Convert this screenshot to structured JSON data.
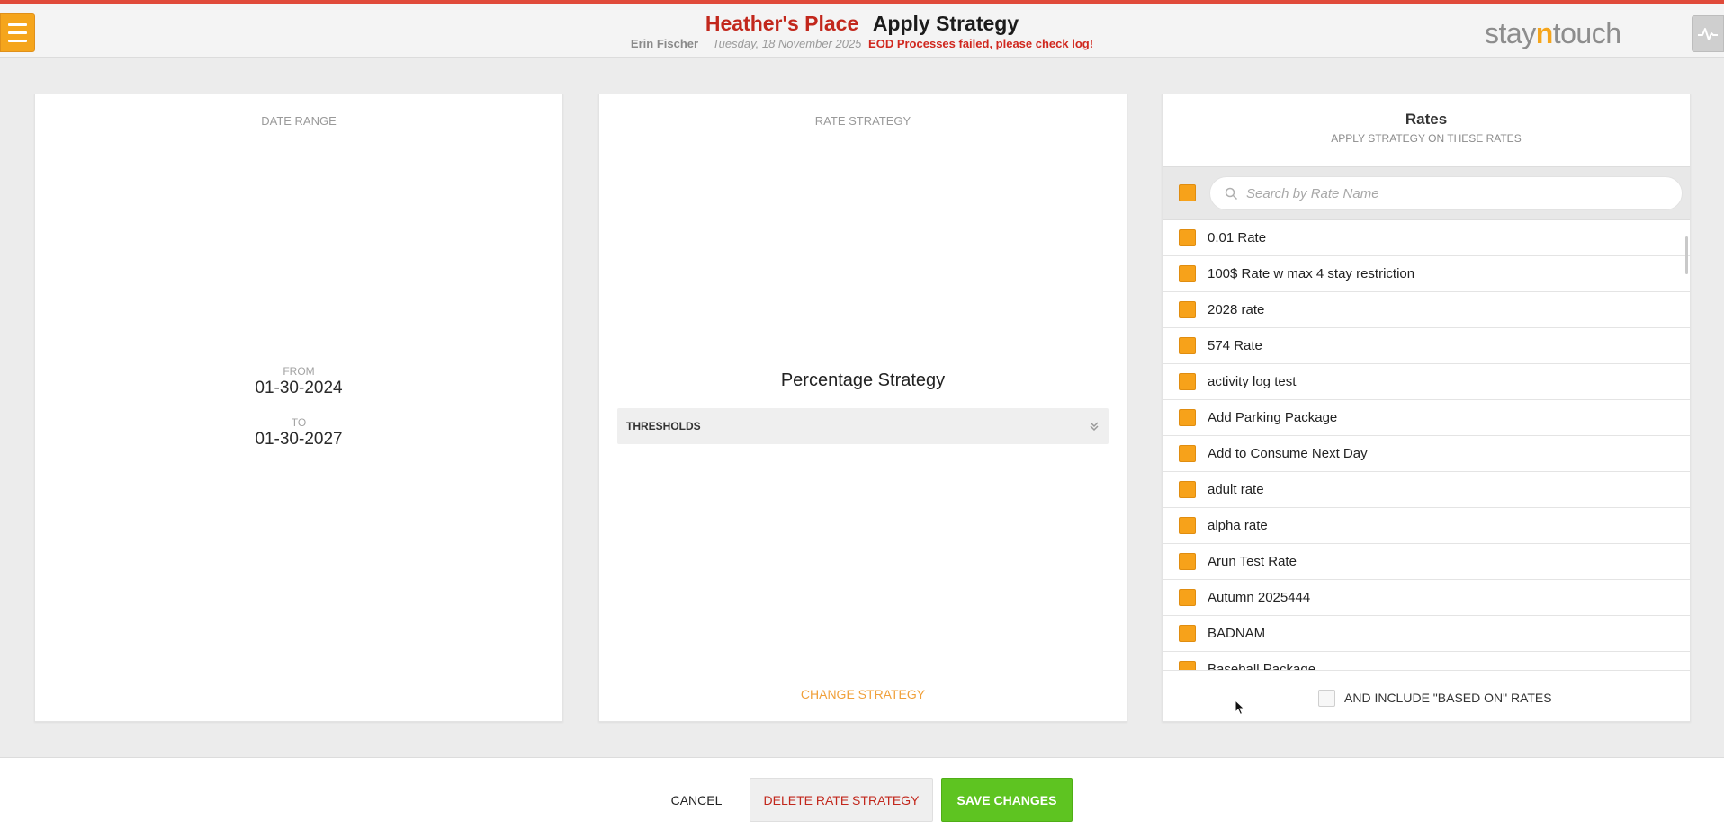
{
  "header": {
    "hotel_name": "Heather's Place",
    "page_title": "Apply Strategy",
    "user_name": "Erin Fischer",
    "date": "Tuesday, 18 November 2025",
    "alert": "EOD Processes failed, please check log!",
    "logo_left": "stay",
    "logo_mid": "n",
    "logo_right": "touch",
    "menu_icon": "hamburger-icon",
    "activity_icon": "pulse-icon"
  },
  "date_range": {
    "heading": "DATE RANGE",
    "from_label": "FROM",
    "from_value": "01-30-2024",
    "to_label": "TO",
    "to_value": "01-30-2027"
  },
  "strategy": {
    "heading": "RATE STRATEGY",
    "name": "Percentage Strategy",
    "thresholds_label": "THRESHOLDS",
    "change_link": "CHANGE STRATEGY"
  },
  "rates": {
    "title": "Rates",
    "subtitle": "APPLY STRATEGY ON THESE RATES",
    "search_placeholder": "Search by Rate Name",
    "items": [
      "0.01 Rate",
      "100$ Rate w max 4 stay restriction",
      "2028 rate",
      "574 Rate",
      "activity log test",
      "Add Parking Package",
      "Add to Consume Next Day",
      "adult rate",
      "alpha rate",
      "Arun Test Rate",
      "Autumn 2025444",
      "BADNAM",
      "Baseball Package"
    ],
    "include_based_on": "AND INCLUDE \"BASED ON\" RATES"
  },
  "footer": {
    "cancel": "CANCEL",
    "delete": "DELETE RATE STRATEGY",
    "save": "SAVE CHANGES"
  },
  "colors": {
    "accent_orange": "#f7a21a",
    "brand_red": "#c2271c",
    "save_green": "#5ec421"
  }
}
